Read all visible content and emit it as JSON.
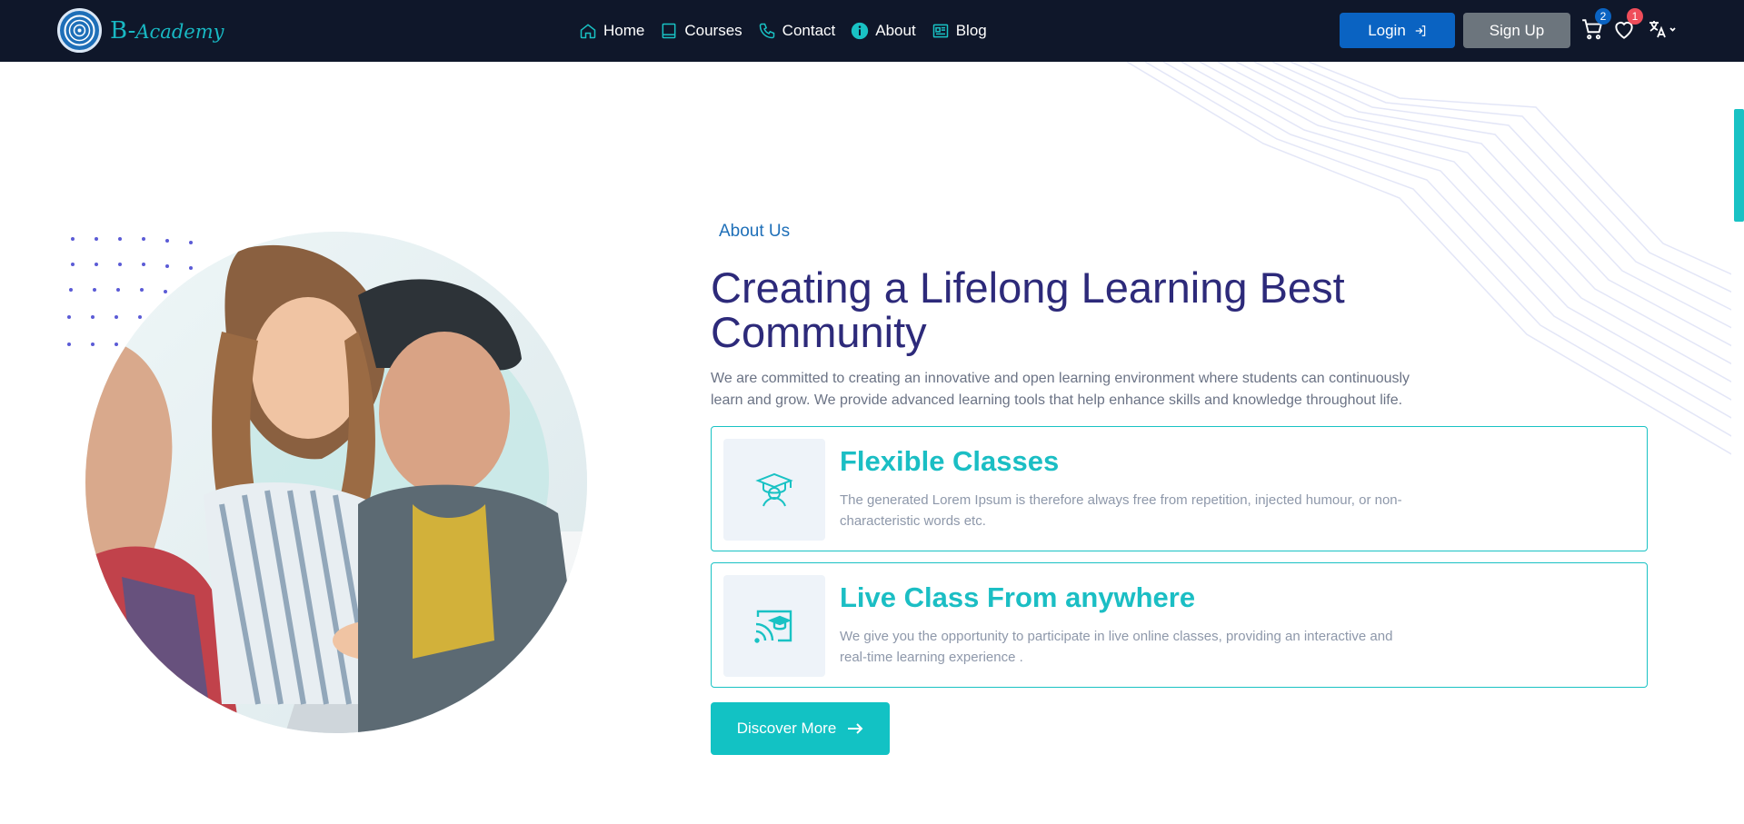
{
  "brand": {
    "name_b": "B-",
    "name_rest": "Academy"
  },
  "nav": {
    "items": [
      {
        "label": "Home",
        "icon": "home-icon"
      },
      {
        "label": "Courses",
        "icon": "book-icon"
      },
      {
        "label": "Contact",
        "icon": "phone-icon"
      },
      {
        "label": "About",
        "icon": "info-icon"
      },
      {
        "label": "Blog",
        "icon": "newspaper-icon"
      }
    ],
    "login_label": "Login",
    "signup_label": "Sign Up",
    "cart_count": "2",
    "wishlist_count": "1"
  },
  "about": {
    "eyebrow": "About Us",
    "title": "Creating a Lifelong Learning Best Community",
    "description": "We are committed to creating an innovative and open learning environment where students can continuously learn and grow. We provide advanced learning tools that help enhance skills and knowledge throughout life.",
    "features": [
      {
        "title": "Flexible Classes",
        "text": "The generated Lorem Ipsum is therefore always free from repetition, injected humour, or non-characteristic words etc.",
        "icon": "graduate-icon"
      },
      {
        "title": "Live Class From anywhere",
        "text": "We give you the opportunity to participate in live online classes, providing an interactive and real-time learning experience .",
        "icon": "cast-graduation-icon"
      }
    ],
    "cta_label": "Discover More"
  },
  "colors": {
    "navbar": "#0f172a",
    "accent": "#19c2c4",
    "primary": "#0a63c2",
    "heading": "#2d2a7a"
  }
}
